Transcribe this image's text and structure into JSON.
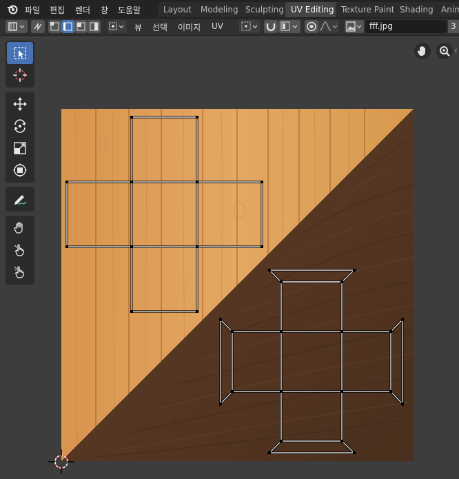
{
  "menubar": {
    "menus": [
      "파일",
      "편집",
      "렌더",
      "창",
      "도움말"
    ],
    "workspaces": [
      "Layout",
      "Modeling",
      "Sculpting",
      "UV Editing",
      "Texture Paint",
      "Shading",
      "Anim"
    ],
    "active_workspace": "UV Editing"
  },
  "header": {
    "menus": [
      "뷰",
      "선택",
      "이미지",
      "UV"
    ],
    "image_name": "fff.jpg",
    "users_count": "3"
  },
  "toolbar": {
    "tools": [
      {
        "name": "select-box",
        "icon": "select-box-icon",
        "active": true
      },
      {
        "name": "cursor",
        "icon": "cursor-icon",
        "active": false
      },
      {
        "name": "move",
        "icon": "move-icon",
        "active": false
      },
      {
        "name": "rotate",
        "icon": "rotate-icon",
        "active": false
      },
      {
        "name": "scale",
        "icon": "scale-icon",
        "active": false
      },
      {
        "name": "transform",
        "icon": "transform-icon",
        "active": false
      },
      {
        "name": "annotate",
        "icon": "annotate-icon",
        "active": false
      },
      {
        "name": "grab",
        "icon": "grab-icon",
        "active": false
      },
      {
        "name": "relax",
        "icon": "relax-icon",
        "active": false
      },
      {
        "name": "pinch",
        "icon": "pinch-icon",
        "active": false
      }
    ]
  },
  "colors": {
    "editor_bg": "#3d3d3d",
    "wood_light": "#d99a58",
    "wood_dark": "#5b3a24",
    "selection_blue": "#4772b3",
    "uv_edge": "#ffffff"
  }
}
